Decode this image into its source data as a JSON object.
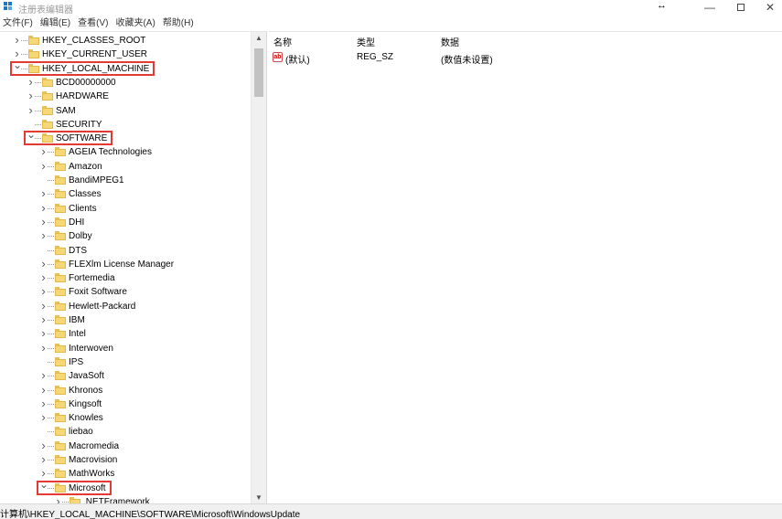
{
  "window": {
    "title": "注册表编辑器",
    "resize_glyph": "↔",
    "minimize_glyph": "—",
    "close_glyph": "✕"
  },
  "menu": [
    "文件(F)",
    "编辑(E)",
    "查看(V)",
    "收藏夹(A)",
    "帮助(H)"
  ],
  "tree": {
    "rows": [
      {
        "label": "HKEY_CLASSES_ROOT",
        "level": 0,
        "chevron": "right"
      },
      {
        "label": "HKEY_CURRENT_USER",
        "level": 0,
        "chevron": "right"
      },
      {
        "label": "HKEY_LOCAL_MACHINE",
        "level": 0,
        "chevron": "down",
        "highlighted": true
      },
      {
        "label": "BCD00000000",
        "level": 1,
        "chevron": "right"
      },
      {
        "label": "HARDWARE",
        "level": 1,
        "chevron": "right"
      },
      {
        "label": "SAM",
        "level": 1,
        "chevron": "right"
      },
      {
        "label": "SECURITY",
        "level": 1,
        "chevron": "none"
      },
      {
        "label": "SOFTWARE",
        "level": 1,
        "chevron": "down",
        "highlighted": true
      },
      {
        "label": "AGEIA Technologies",
        "level": 2,
        "chevron": "right"
      },
      {
        "label": "Amazon",
        "level": 2,
        "chevron": "right"
      },
      {
        "label": "BandiMPEG1",
        "level": 2,
        "chevron": "none"
      },
      {
        "label": "Classes",
        "level": 2,
        "chevron": "right"
      },
      {
        "label": "Clients",
        "level": 2,
        "chevron": "right"
      },
      {
        "label": "DHI",
        "level": 2,
        "chevron": "right"
      },
      {
        "label": "Dolby",
        "level": 2,
        "chevron": "right"
      },
      {
        "label": "DTS",
        "level": 2,
        "chevron": "none"
      },
      {
        "label": "FLEXlm License Manager",
        "level": 2,
        "chevron": "right"
      },
      {
        "label": "Fortemedia",
        "level": 2,
        "chevron": "right"
      },
      {
        "label": "Foxit Software",
        "level": 2,
        "chevron": "right"
      },
      {
        "label": "Hewlett-Packard",
        "level": 2,
        "chevron": "right"
      },
      {
        "label": "IBM",
        "level": 2,
        "chevron": "right"
      },
      {
        "label": "Intel",
        "level": 2,
        "chevron": "right"
      },
      {
        "label": "Interwoven",
        "level": 2,
        "chevron": "right"
      },
      {
        "label": "IPS",
        "level": 2,
        "chevron": "none"
      },
      {
        "label": "JavaSoft",
        "level": 2,
        "chevron": "right"
      },
      {
        "label": "Khronos",
        "level": 2,
        "chevron": "right"
      },
      {
        "label": "Kingsoft",
        "level": 2,
        "chevron": "right"
      },
      {
        "label": "Knowles",
        "level": 2,
        "chevron": "right"
      },
      {
        "label": "liebao",
        "level": 2,
        "chevron": "none"
      },
      {
        "label": "Macromedia",
        "level": 2,
        "chevron": "right"
      },
      {
        "label": "Macrovision",
        "level": 2,
        "chevron": "right"
      },
      {
        "label": "MathWorks",
        "level": 2,
        "chevron": "right"
      },
      {
        "label": "Microsoft",
        "level": 2,
        "chevron": "down",
        "highlighted": true
      },
      {
        "label": ".NETFramework",
        "level": 3,
        "chevron": "right"
      }
    ]
  },
  "values": {
    "columns": {
      "name": "名称",
      "type": "类型",
      "data": "数据"
    },
    "rows": [
      {
        "icon": "string-value-icon",
        "icon_text": "ab",
        "name": "(默认)",
        "type": "REG_SZ",
        "data": "(数值未设置)"
      }
    ]
  },
  "status": {
    "path": "计算机\\HKEY_LOCAL_MACHINE\\SOFTWARE\\Microsoft\\WindowsUpdate"
  },
  "colors": {
    "highlight_border": "#e53935",
    "folder": "#f5d777",
    "app_icon": "#1e76c9"
  }
}
